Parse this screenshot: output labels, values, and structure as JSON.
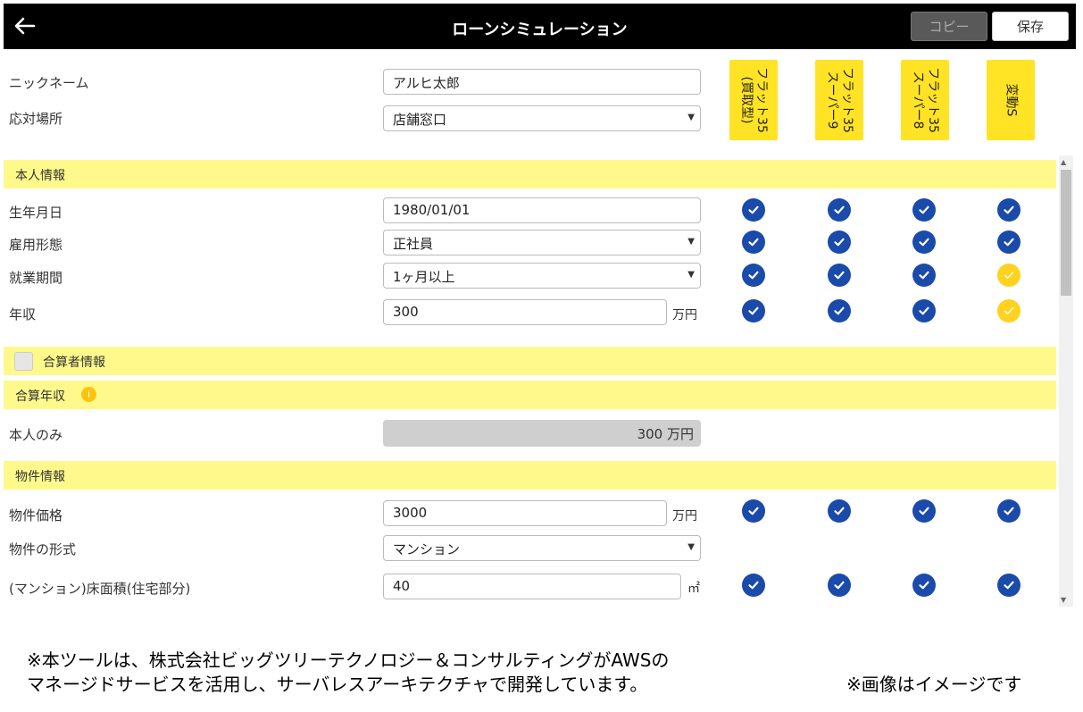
{
  "header": {
    "title": "ローンシミュレーション",
    "copy_label": "コピー",
    "save_label": "保存",
    "back_icon": "arrow-left-icon"
  },
  "form": {
    "nickname": {
      "label": "ニックネーム",
      "value": "アルヒ太郎"
    },
    "location": {
      "label": "応対場所",
      "value": "店舗窓口"
    }
  },
  "plans": [
    {
      "line1": "フラット35",
      "line2": "(買取型)"
    },
    {
      "line1": "フラット35",
      "line2": "スーパー9"
    },
    {
      "line1": "フラット35",
      "line2": "スーパー8"
    },
    {
      "line1": "変動S",
      "line2": ""
    }
  ],
  "sections": {
    "personal": "本人情報",
    "co_applicant": "合算者情報",
    "combined_income": "合算年収",
    "property": "物件情報"
  },
  "personal": {
    "birthdate": {
      "label": "生年月日",
      "value": "1980/01/01"
    },
    "employment": {
      "label": "雇用形態",
      "value": "正社員"
    },
    "tenure": {
      "label": "就業期間",
      "value": "1ヶ月以上"
    },
    "income": {
      "label": "年収",
      "value": "300",
      "unit": "万円"
    }
  },
  "combined": {
    "label": "本人のみ",
    "value": "300 万円"
  },
  "property": {
    "price": {
      "label": "物件価格",
      "value": "3000",
      "unit": "万円"
    },
    "type": {
      "label": "物件の形式",
      "value": "マンション"
    },
    "area": {
      "label": "(マンション)床面積(住宅部分)",
      "value": "40",
      "unit": "㎡"
    }
  },
  "status_colors": {
    "ok": "#1a4aaa",
    "caution": "#ffd21f",
    "section_bg": "#fff98c",
    "plan_bg": "#ffe324"
  },
  "checks": {
    "birthdate": [
      "ok",
      "ok",
      "ok",
      "ok"
    ],
    "employment": [
      "ok",
      "ok",
      "ok",
      "ok"
    ],
    "tenure": [
      "ok",
      "ok",
      "ok",
      "caution"
    ],
    "income": [
      "ok",
      "ok",
      "ok",
      "caution"
    ],
    "price": [
      "ok",
      "ok",
      "ok",
      "ok"
    ],
    "area": [
      "ok",
      "ok",
      "ok",
      "ok"
    ]
  },
  "footnote": {
    "line1": "※本ツールは、株式会社ビッグツリーテクノロジー＆コンサルティングがAWSの",
    "line2": "マネージドサービスを活用し、サーバレスアーキテクチャで開発しています。",
    "right": "※画像はイメージです"
  }
}
